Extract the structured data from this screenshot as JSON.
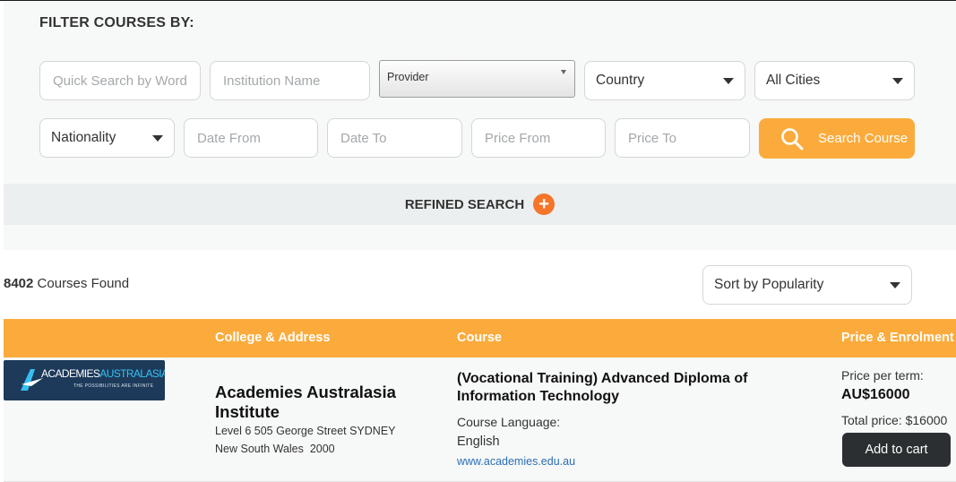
{
  "filter": {
    "title": "FILTER COURSES BY:",
    "quick_search_placeholder": "Quick Search by Word",
    "institution_placeholder": "Institution Name",
    "provider_value": "Provider",
    "country_value": "Country",
    "city_value": "All Cities",
    "nationality_value": "Nationality",
    "date_from_placeholder": "Date From",
    "date_to_placeholder": "Date To",
    "price_from_placeholder": "Price From",
    "price_to_placeholder": "Price To",
    "search_button_label": "Search Course"
  },
  "refine": {
    "label": "REFINED SEARCH",
    "icon": "plus-circle-icon"
  },
  "results": {
    "count": "8402",
    "count_suffix": "Courses Found",
    "sort_value": "Sort by Popularity"
  },
  "table": {
    "headers": {
      "college": "College & Address",
      "course": "Course",
      "price": "Price & Enrolment"
    },
    "rows": [
      {
        "logo": {
          "word_a": "ACADEMIES",
          "word_b": "AUSTRALASIA",
          "tagline": "THE POSSIBILITIES ARE INFINITE"
        },
        "college_name": "Academies Australasia Institute",
        "address_line1": "Level 6 505 George Street SYDNEY",
        "address_line2": "New South Wales  2000",
        "course_title": "(Vocational Training) Advanced Diploma of Information Technology",
        "language_label": "Course Language:",
        "language": "English",
        "website": "www.academies.edu.au",
        "price_label": "Price per term:",
        "price": "AU$16000",
        "total_price": "Total price: $16000",
        "cart_label": "Add to cart"
      }
    ]
  },
  "colors": {
    "accent": "#fbab3c",
    "refine_icon": "#f5752a",
    "dark_button": "#2b2f31",
    "link": "#2a6fb5"
  }
}
